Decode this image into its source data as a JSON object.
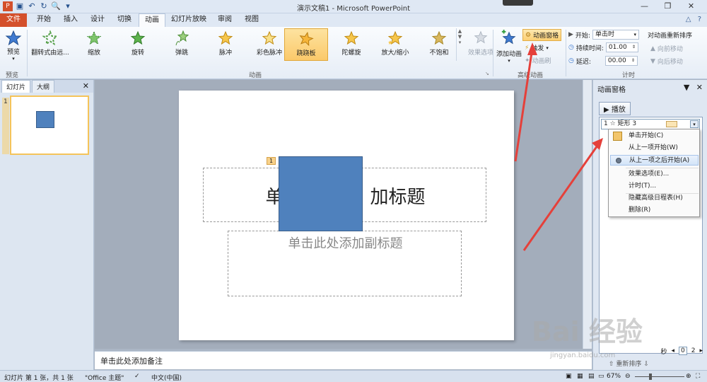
{
  "window": {
    "title": "演示文稿1 - Microsoft PowerPoint",
    "qat_icons": [
      "save-icon",
      "undo-icon",
      "redo-icon",
      "print-preview-icon"
    ]
  },
  "tabs": [
    {
      "label": "文件"
    },
    {
      "label": "开始"
    },
    {
      "label": "插入"
    },
    {
      "label": "设计"
    },
    {
      "label": "切换"
    },
    {
      "label": "动画"
    },
    {
      "label": "幻灯片放映"
    },
    {
      "label": "审阅"
    },
    {
      "label": "视图"
    }
  ],
  "ribbon": {
    "preview": {
      "label": "预览",
      "group": "预览"
    },
    "animations": [
      {
        "label": "翻转式由远..."
      },
      {
        "label": "缩放"
      },
      {
        "label": "旋转"
      },
      {
        "label": "弹跳"
      },
      {
        "label": "脉冲"
      },
      {
        "label": "彩色脉冲"
      },
      {
        "label": "跷跷板"
      },
      {
        "label": "陀螺旋"
      },
      {
        "label": "放大/缩小"
      },
      {
        "label": "不饱和"
      }
    ],
    "effect_options": "效果选项",
    "group_animation": "动画",
    "add_animation": "添加动画",
    "animation_pane": "动画窗格",
    "trigger": "触发",
    "animation_painter": "动画刷",
    "group_advanced": "高级动画",
    "start_label": "开始:",
    "start_value": "单击时",
    "duration_label": "持续时间:",
    "duration_value": "01.00",
    "delay_label": "延迟:",
    "delay_value": "00.00",
    "reorder_title": "对动画重新排序",
    "move_earlier": "向前移动",
    "move_later": "向后移动",
    "group_timing": "计时"
  },
  "left_pane": {
    "tab_slides": "幻灯片",
    "tab_outline": "大纲",
    "slide_number": "1"
  },
  "slide": {
    "anim_tag": "1",
    "title_left": "单",
    "title_right": "加标题",
    "subtitle": "单击此处添加副标题"
  },
  "notes": "单击此处添加备注",
  "anim_pane": {
    "title": "动画窗格",
    "play": "▶ 播放",
    "item": "1 ☆ 矩形 3",
    "seconds": "秒",
    "timeline_start": "0",
    "timeline_end": "2",
    "reorder": "重新排序"
  },
  "context_menu": [
    {
      "label": "单击开始(C)"
    },
    {
      "label": "从上一项开始(W)"
    },
    {
      "label": "从上一项之后开始(A)"
    },
    {
      "label": "效果选项(E)..."
    },
    {
      "label": "计时(T)..."
    },
    {
      "label": "隐藏高级日程表(H)"
    },
    {
      "label": "删除(R)"
    }
  ],
  "status": {
    "slide_info": "幻灯片 第 1 张，共 1 张",
    "theme": "\"Office 主题\"",
    "language": "中文(中国)",
    "zoom": "67%"
  },
  "watermark": {
    "text": "Bai 经验",
    "url": "jingyan.baidu.com"
  },
  "colors": {
    "file_tab": "#d4502b",
    "shape_fill": "#4f81bd",
    "accent": "#fccf73",
    "arrow": "#e5403a"
  }
}
